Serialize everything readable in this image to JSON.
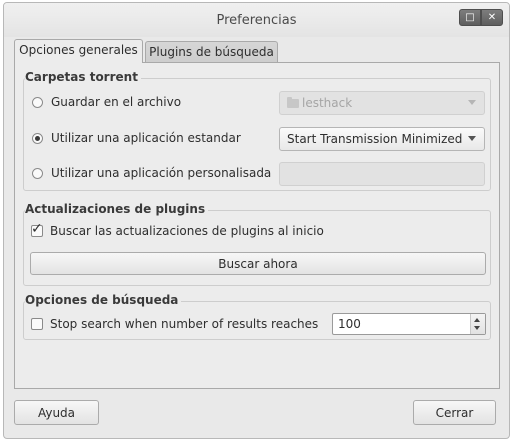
{
  "window": {
    "title": "Preferencias"
  },
  "tabs": [
    {
      "label": "Opciones generales",
      "active": true
    },
    {
      "label": "Plugins de búsqueda",
      "active": false
    }
  ],
  "torrent_group": {
    "title": "Carpetas torrent",
    "options": [
      {
        "label": "Guardar en el archivo",
        "selected": false,
        "value": "lesthack",
        "enabled": false
      },
      {
        "label": "Utilizar una aplicación estandar",
        "selected": true,
        "value": "Start Transmission Minimized",
        "enabled": true
      },
      {
        "label": "Utilizar una aplicación personalisada",
        "selected": false,
        "value": "",
        "enabled": false
      }
    ]
  },
  "updates_group": {
    "title": "Actualizaciones de plugins",
    "check_label": "Buscar las actualizaciones de plugins al inicio",
    "checked": true,
    "button_label": "Buscar ahora"
  },
  "search_group": {
    "title": "Opciones de búsqueda",
    "check_label": "Stop search when number of results reaches",
    "checked": false,
    "value": "100"
  },
  "footer": {
    "help_label": "Ayuda",
    "close_label": "Cerrar"
  }
}
